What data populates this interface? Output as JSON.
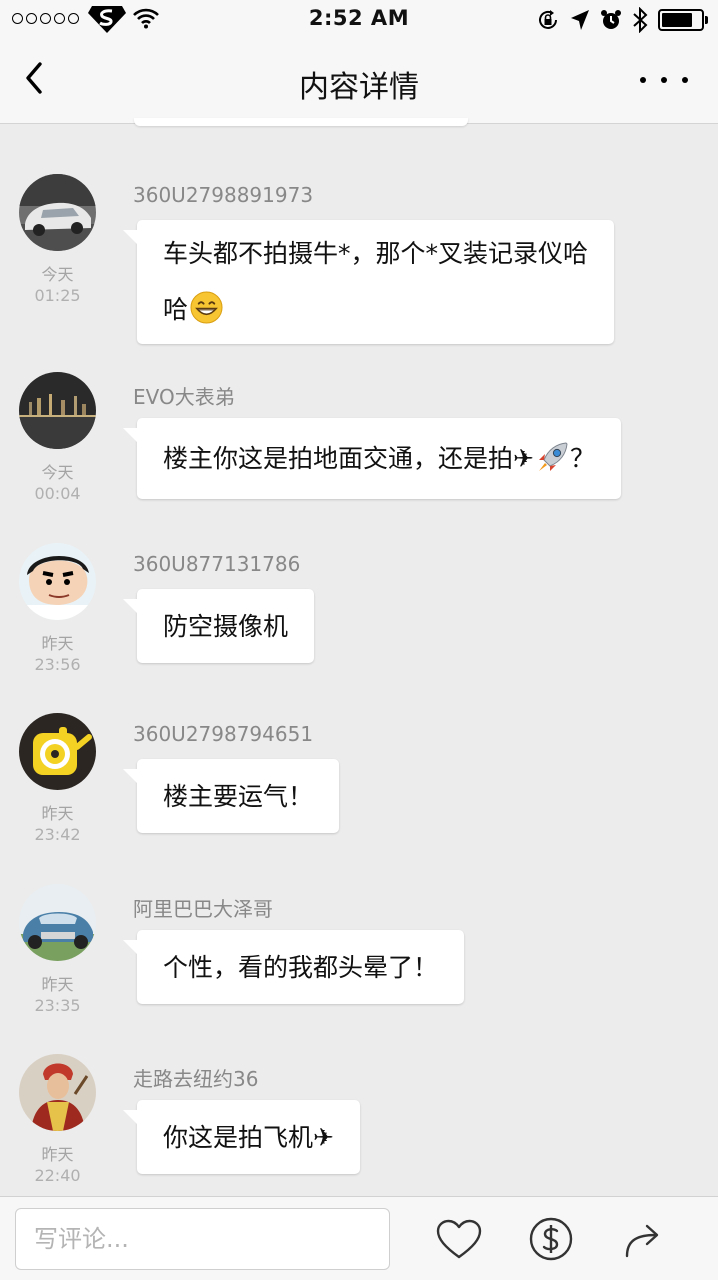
{
  "status_bar": {
    "time": "2:52 AM",
    "icons": [
      "signal-dots-icon",
      "carrier-logo-icon",
      "wifi-icon",
      "rotation-lock-icon",
      "location-icon",
      "alarm-icon",
      "bluetooth-icon",
      "battery-icon"
    ],
    "battery_level": 0.78
  },
  "nav": {
    "title": "内容详情",
    "back_icon": "chevron-left-icon",
    "more_icon": "more-dots-icon"
  },
  "comments": [
    {
      "username": "360U2798891973",
      "date": "今天",
      "time": "01:25",
      "lines": [
        "车头都不拍摄牛*，那个*叉装记录仪哈",
        "哈"
      ],
      "emoji": "grinning-face-icon"
    },
    {
      "username": "EVO大表弟",
      "date": "今天",
      "time": "00:04",
      "text_before": "楼主你这是拍地面交通，还是拍✈",
      "text_after": "？",
      "emoji": "rocket-icon"
    },
    {
      "username": "360U877131786",
      "date": "昨天",
      "time": "23:56",
      "text": "防空摄像机"
    },
    {
      "username": "360U2798794651",
      "date": "昨天",
      "time": "23:42",
      "text": "楼主要运气！"
    },
    {
      "username": "阿里巴巴大泽哥",
      "date": "昨天",
      "time": "23:35",
      "text": "个性，看的我都头晕了！"
    },
    {
      "username": "走路去纽约36",
      "date": "昨天",
      "time": "22:40",
      "text": "你这是拍飞机✈"
    }
  ],
  "bottom_bar": {
    "input_placeholder": "写评论...",
    "actions": [
      "heart-icon",
      "dollar-icon",
      "share-icon"
    ]
  },
  "colors": {
    "page_bg": "#ececec",
    "bar_bg": "#f7f7f7",
    "bubble_bg": "#ffffff",
    "username": "#888888",
    "timestamp": "#a4a4a4"
  }
}
